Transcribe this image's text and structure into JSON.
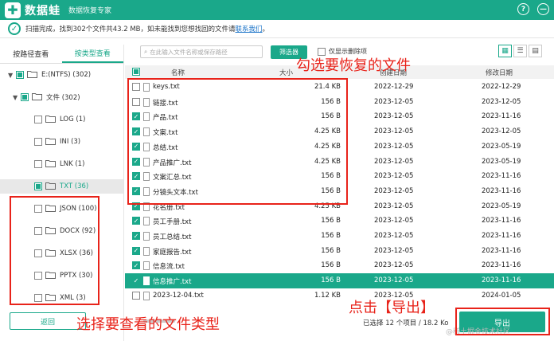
{
  "app": {
    "name": "数据蛙",
    "subtitle": "数据恢复专家",
    "help_icon": "?",
    "min_icon": "—"
  },
  "status": {
    "text": "扫描完成，找到302个文件共43.2 MB，如未能找到您想找回的文件请",
    "link": "联系我们",
    "end": "。"
  },
  "tabs": [
    {
      "label": "按路径查看"
    },
    {
      "label": "按类型查看"
    }
  ],
  "tree": {
    "drive": "E:(NTFS) (302)",
    "files": "文件 (302)",
    "types": [
      "LOG (1)",
      "INI (3)",
      "LNK (1)",
      "TXT (36)",
      "JSON (100)",
      "DOCX (92)",
      "XLSX (36)",
      "PPTX (30)",
      "XML (3)"
    ]
  },
  "toolbar": {
    "search_placeholder": "在此输入文件名称或保存路径",
    "filter_label": "筛选器",
    "deleted_only_label": "仅显示删除项"
  },
  "table": {
    "headers": {
      "name": "名称",
      "size": "大小",
      "created": "创建日期",
      "modified": "修改日期"
    },
    "rows": [
      {
        "name": "keys.txt",
        "size": "21.4 KB",
        "created": "2022-12-29",
        "modified": "2022-12-29",
        "checked": false
      },
      {
        "name": "链接.txt",
        "size": "156  B",
        "created": "2023-12-05",
        "modified": "2023-12-05",
        "checked": false
      },
      {
        "name": "产品.txt",
        "size": "156  B",
        "created": "2023-12-05",
        "modified": "2023-11-16",
        "checked": true
      },
      {
        "name": "文案.txt",
        "size": "4.25 KB",
        "created": "2023-12-05",
        "modified": "2023-12-05",
        "checked": true
      },
      {
        "name": "总结.txt",
        "size": "4.25 KB",
        "created": "2023-12-05",
        "modified": "2023-05-19",
        "checked": true
      },
      {
        "name": "产品推广.txt",
        "size": "4.25 KB",
        "created": "2023-12-05",
        "modified": "2023-05-19",
        "checked": true
      },
      {
        "name": "文案汇总.txt",
        "size": "156  B",
        "created": "2023-12-05",
        "modified": "2023-11-16",
        "checked": true
      },
      {
        "name": "分镜头文本.txt",
        "size": "156  B",
        "created": "2023-12-05",
        "modified": "2023-11-16",
        "checked": true
      },
      {
        "name": "花名册.txt",
        "size": "4.25 KB",
        "created": "2023-12-05",
        "modified": "2023-05-19",
        "checked": true
      },
      {
        "name": "员工手册.txt",
        "size": "156  B",
        "created": "2023-12-05",
        "modified": "2023-11-16",
        "checked": true
      },
      {
        "name": "员工总结.txt",
        "size": "156  B",
        "created": "2023-12-05",
        "modified": "2023-11-16",
        "checked": true
      },
      {
        "name": "家庭报告.txt",
        "size": "156  B",
        "created": "2023-12-05",
        "modified": "2023-11-16",
        "checked": true
      },
      {
        "name": "信息流.txt",
        "size": "156  B",
        "created": "2023-12-05",
        "modified": "2023-11-16",
        "checked": true
      },
      {
        "name": "信息推广.txt",
        "size": "156  B",
        "created": "2023-12-05",
        "modified": "2023-11-16",
        "checked": true,
        "highlight": true
      },
      {
        "name": "2023-12-04.txt",
        "size": "1.12 KB",
        "created": "2023-12-05",
        "modified": "2024-01-05",
        "checked": false
      }
    ]
  },
  "footer": {
    "back_label": "返回",
    "summary": "已选择 12 个项目 / 18.2 Ko",
    "export_label": "导出",
    "watermark": "@稀土掘金技术社区"
  },
  "annotations": {
    "select_files": "勾选要恢复的文件",
    "select_type": "选择要查看的文件类型",
    "click_export": "点击【导出】"
  },
  "colors": {
    "brand": "#1aa88a",
    "annotation": "#e8231a"
  }
}
